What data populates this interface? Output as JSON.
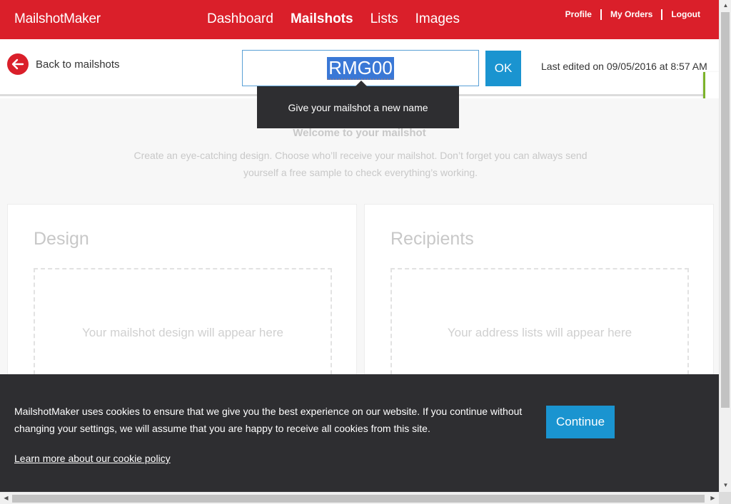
{
  "header": {
    "logo": "MailshotMaker",
    "nav": [
      {
        "label": "Dashboard"
      },
      {
        "label": "Mailshots"
      },
      {
        "label": "Lists"
      },
      {
        "label": "Images"
      }
    ],
    "user_links": [
      {
        "label": "Profile"
      },
      {
        "label": "My Orders"
      },
      {
        "label": "Logout"
      }
    ],
    "brand_color": "#da1f2a"
  },
  "subbar": {
    "back_label": "Back to mailshots",
    "name_value": "RMG00",
    "ok_label": "OK",
    "last_edited": "Last edited on 09/05/2016 at 8:57 AM",
    "tooltip": "Give your mailshot a new name"
  },
  "main": {
    "welcome": "Welcome to your mailshot",
    "intro": "Create an eye-catching design. Choose who’ll receive your mailshot. Don’t forget you can always send yourself a free sample to check everything’s working.",
    "design": {
      "title": "Design",
      "placeholder": "Your mailshot design will appear here"
    },
    "recipients": {
      "title": "Recipients",
      "placeholder": "Your address lists will appear here"
    }
  },
  "cookie": {
    "text": "MailshotMaker uses cookies to ensure that we give you the best experience on our website. If you continue without changing your settings, we will assume that you are happy to receive all cookies from this site.",
    "link": "Learn more about our cookie policy",
    "continue_label": "Continue"
  },
  "colors": {
    "accent": "#1a94d0",
    "dark": "#2e2e31",
    "side_tab": "#7cb32a"
  }
}
